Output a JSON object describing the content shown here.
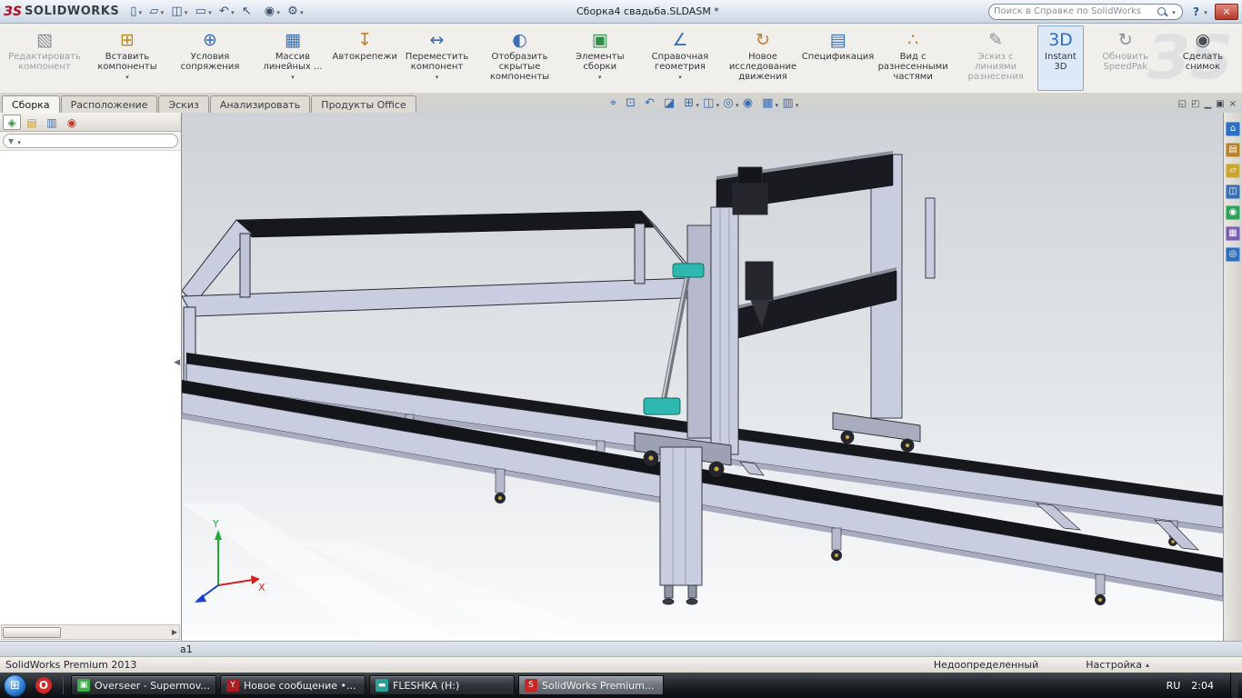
{
  "colors": {
    "accent": "#2e6fc0",
    "teal": "#2fb8b0",
    "model-body": "#c9cde0",
    "titlebar-top": "#f2f6fa",
    "titlebar-bottom": "#c9d6e4",
    "ribbon-bg": "#f1efec",
    "taskbar-top": "#42474e",
    "taskbar-bottom": "#0d0f12"
  },
  "titlebar": {
    "logo_mark": "ЗS",
    "app_name": "SOLIDWORKS",
    "doc_title": "Сборка4 свадьба.SLDASM *",
    "search_placeholder": "Поиск в Справке по SolidWorks",
    "help": "?",
    "close": "×",
    "tools": [
      {
        "name": "new-document-button",
        "glyph": "▯",
        "dropdown": true
      },
      {
        "name": "open-document-button",
        "glyph": "▱",
        "dropdown": true
      },
      {
        "name": "save-button",
        "glyph": "◫",
        "dropdown": true
      },
      {
        "name": "print-button",
        "glyph": "▭",
        "dropdown": true
      },
      {
        "name": "undo-button",
        "glyph": "↶",
        "dropdown": true
      },
      {
        "name": "select-button",
        "glyph": "↖",
        "dropdown": false
      },
      {
        "name": "rebuild-button",
        "glyph": "◉",
        "dropdown": true
      },
      {
        "name": "options-button",
        "glyph": "⚙",
        "dropdown": true
      }
    ]
  },
  "ribbon": {
    "buttons": [
      {
        "name": "edit-component-button",
        "label": "Редактировать компонент",
        "glyph": "▧",
        "color": "#8a9097",
        "disabled": true
      },
      {
        "name": "insert-components-button",
        "label": "Вставить компоненты",
        "glyph": "⊞",
        "color": "#b98c1e",
        "dropdown": true
      },
      {
        "name": "mate-button",
        "label": "Условия сопряжения",
        "glyph": "⊕",
        "color": "#3a6db2"
      },
      {
        "name": "linear-pattern-button",
        "label": "Массив линейных ...",
        "glyph": "▦",
        "color": "#3a6db2",
        "dropdown": true
      },
      {
        "name": "smart-fasteners-button",
        "label": "Автокрепежи",
        "glyph": "↧",
        "color": "#b9812a"
      },
      {
        "name": "move-component-button",
        "label": "Переместить компонент",
        "glyph": "↔",
        "color": "#3a6db2",
        "dropdown": true
      },
      {
        "name": "show-hidden-components-button",
        "label": "Отобразить скрытые компоненты",
        "glyph": "◐",
        "color": "#3a6db2"
      },
      {
        "name": "assembly-features-button",
        "label": "Элементы сборки",
        "glyph": "▣",
        "color": "#2f8f46",
        "dropdown": true
      },
      {
        "name": "reference-geometry-button",
        "label": "Справочная геометрия",
        "glyph": "∠",
        "color": "#3a6db2",
        "dropdown": true
      },
      {
        "name": "new-motion-study-button",
        "label": "Новое исследование движения",
        "glyph": "↻",
        "color": "#b9812a"
      },
      {
        "name": "bill-of-materials-button",
        "label": "Спецификация",
        "glyph": "▤",
        "color": "#3a6db2"
      },
      {
        "name": "exploded-view-button",
        "label": "Вид с разнесенными частями",
        "glyph": "∴",
        "color": "#b9812a"
      },
      {
        "name": "explode-line-sketch-button",
        "label": "Эскиз с линиями разнесения",
        "glyph": "✎",
        "color": "#8a9097",
        "disabled": true
      },
      {
        "name": "instant-3d-button",
        "label": "Instant 3D",
        "glyph": "3D",
        "color": "#2e6fc0",
        "active": true
      },
      {
        "name": "update-speedpak-button",
        "label": "Обновить SpeedPak",
        "glyph": "↻",
        "color": "#8a9097",
        "disabled": true
      },
      {
        "name": "take-snapshot-button",
        "label": "Сделать снимок",
        "glyph": "◉",
        "color": "#4a4f55"
      }
    ]
  },
  "command_tabs": [
    {
      "name": "tab-assembly",
      "label": "Сборка",
      "active": true
    },
    {
      "name": "tab-layout",
      "label": "Расположение"
    },
    {
      "name": "tab-sketch",
      "label": "Эскиз"
    },
    {
      "name": "tab-evaluate",
      "label": "Анализировать"
    },
    {
      "name": "tab-office-products",
      "label": "Продукты Office"
    }
  ],
  "heads_up": [
    {
      "name": "zoom-fit-button",
      "glyph": "⌖"
    },
    {
      "name": "zoom-area-button",
      "glyph": "⊡"
    },
    {
      "name": "previous-view-button",
      "glyph": "↶"
    },
    {
      "name": "section-view-button",
      "glyph": "◪"
    },
    {
      "name": "view-orientation-button",
      "glyph": "⊞",
      "dropdown": true
    },
    {
      "name": "display-style-button",
      "glyph": "◫",
      "dropdown": true
    },
    {
      "name": "hide-show-items-button",
      "glyph": "◎",
      "dropdown": true
    },
    {
      "name": "edit-appearance-button",
      "glyph": "◉"
    },
    {
      "name": "apply-scene-button",
      "glyph": "▦",
      "dropdown": true
    },
    {
      "name": "view-settings-button",
      "glyph": "▥",
      "dropdown": true
    }
  ],
  "doc_controls": [
    {
      "name": "doc-pane-left-button",
      "glyph": "◱"
    },
    {
      "name": "doc-pane-right-button",
      "glyph": "◰"
    },
    {
      "name": "doc-minimize-button",
      "glyph": "▁"
    },
    {
      "name": "doc-restore-button",
      "glyph": "▣"
    },
    {
      "name": "doc-close-button",
      "glyph": "×"
    }
  ],
  "feature_panel": {
    "tabs": [
      {
        "name": "featuremanager-tree-tab",
        "glyph": "◈",
        "color": "#2f8f46",
        "active": true
      },
      {
        "name": "propertymanager-tab",
        "glyph": "▤",
        "color": "#c59a2a"
      },
      {
        "name": "configurationmanager-tab",
        "glyph": "▥",
        "color": "#3a6db2"
      },
      {
        "name": "displaymanager-tab",
        "glyph": "◉",
        "color": "#c0392b"
      }
    ],
    "expand": "»",
    "filter_funnel": "▼",
    "splitter_arrow": "◀",
    "scroll_arrow": "▶"
  },
  "task_pane": [
    {
      "name": "solidworks-resources-tab",
      "glyph": "⌂",
      "color": "#2e6fc0"
    },
    {
      "name": "design-library-tab",
      "glyph": "▤",
      "color": "#b9812a"
    },
    {
      "name": "file-explorer-tab",
      "glyph": "▱",
      "color": "#caa532"
    },
    {
      "name": "view-palette-tab",
      "glyph": "◫",
      "color": "#3a6db2"
    },
    {
      "name": "appearances-scenes-tab",
      "glyph": "◉",
      "color": "#2fa05a"
    },
    {
      "name": "custom-properties-tab",
      "glyph": "▦",
      "color": "#7a5db0"
    },
    {
      "name": "forum-tab",
      "glyph": "◎",
      "color": "#2e6fc0"
    }
  ],
  "viewport": {
    "model_tab": "а1",
    "triad_x": "X",
    "triad_y": "Y"
  },
  "statusbar": {
    "product": "SolidWorks Premium 2013",
    "state": "Недоопределенный",
    "customize": "Настройка",
    "arrow": "▴"
  },
  "taskbar": {
    "start_glyph": "⊞",
    "quick_launch": [
      {
        "name": "opera-quicklaunch",
        "glyph": "O",
        "color": "#cf2a27"
      }
    ],
    "windows": [
      {
        "name": "taskbar-overseer",
        "label": "Overseer - Supermov...",
        "glyph": "▣",
        "color": "#3fae49"
      },
      {
        "name": "taskbar-new-message",
        "label": "Новое сообщение •...",
        "glyph": "Y",
        "color": "#a81e22"
      },
      {
        "name": "taskbar-fleshka",
        "label": "FLESHKA (H:)",
        "glyph": "▬",
        "color": "#2aa198"
      },
      {
        "name": "taskbar-solidworks",
        "label": "SolidWorks Premium...",
        "glyph": "S",
        "color": "#c62828",
        "active": true
      }
    ],
    "lang": "RU",
    "clock": "2:04"
  }
}
